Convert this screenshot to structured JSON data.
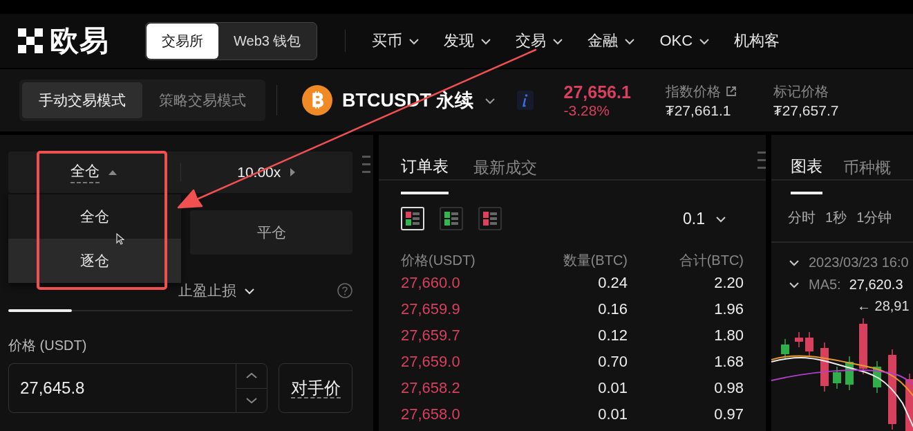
{
  "nav": {
    "logo": "欧易",
    "switch": [
      {
        "label": "交易所",
        "selected": true
      },
      {
        "label": "Web3 钱包",
        "selected": false
      }
    ],
    "menu": [
      {
        "label": "买币",
        "caret": true
      },
      {
        "label": "发现",
        "caret": true
      },
      {
        "label": "交易",
        "caret": true
      },
      {
        "label": "金融",
        "caret": true
      },
      {
        "label": "OKC",
        "caret": true
      },
      {
        "label": "机构客",
        "caret": false
      }
    ]
  },
  "ticker": {
    "modes": [
      {
        "label": "手动交易模式",
        "selected": true
      },
      {
        "label": "策略交易模式",
        "selected": false
      }
    ],
    "symbol": "BTCUSDT 永续",
    "last_price": "27,656.1",
    "change": "-3.28%",
    "stats": [
      {
        "label": "指数价格",
        "link": true,
        "value": "₮27,661.1"
      },
      {
        "label": "标记价格",
        "link": false,
        "value": "₮27,657.7"
      }
    ]
  },
  "trade_panel": {
    "margin_mode": "全仓",
    "leverage": "10.00x",
    "margin_menu": [
      {
        "label": "全仓",
        "selected": true
      },
      {
        "label": "逐仓",
        "selected": false
      }
    ],
    "side_buttons": [
      {
        "label": "平仓"
      }
    ],
    "order_tabs": [
      {
        "label": "止盈止损",
        "selected": false,
        "caret": true
      }
    ],
    "price_label": "价格 (USDT)",
    "price_value": "27,645.8",
    "counter_price_button": "对手价"
  },
  "order_book": {
    "tabs": [
      {
        "label": "订单表",
        "selected": true
      },
      {
        "label": "最新成交",
        "selected": false
      }
    ],
    "views": [
      {
        "kind": "both",
        "selected": true
      },
      {
        "kind": "bids",
        "selected": false
      },
      {
        "kind": "asks",
        "selected": false
      }
    ],
    "tick_size": "0.1",
    "columns": [
      "价格(USDT)",
      "数量(BTC)",
      "合计(BTC)"
    ],
    "rows": [
      {
        "price": "27,660.0",
        "amount": "0.24",
        "total": "2.20"
      },
      {
        "price": "27,659.9",
        "amount": "0.16",
        "total": "1.96"
      },
      {
        "price": "27,659.7",
        "amount": "0.12",
        "total": "1.80"
      },
      {
        "price": "27,659.0",
        "amount": "0.70",
        "total": "1.68"
      },
      {
        "price": "27,658.2",
        "amount": "0.01",
        "total": "0.98"
      },
      {
        "price": "27,658.0",
        "amount": "0.01",
        "total": "0.97"
      }
    ]
  },
  "chart": {
    "tabs": [
      {
        "label": "图表",
        "selected": true
      },
      {
        "label": "币种概",
        "selected": false
      }
    ],
    "intervals": [
      "分时",
      "1秒",
      "1分钟"
    ],
    "date": "2023/03/23 16:0",
    "ma_label": "MA5:",
    "ma_value": "27,620.3",
    "high_marker": "← 28,91"
  }
}
